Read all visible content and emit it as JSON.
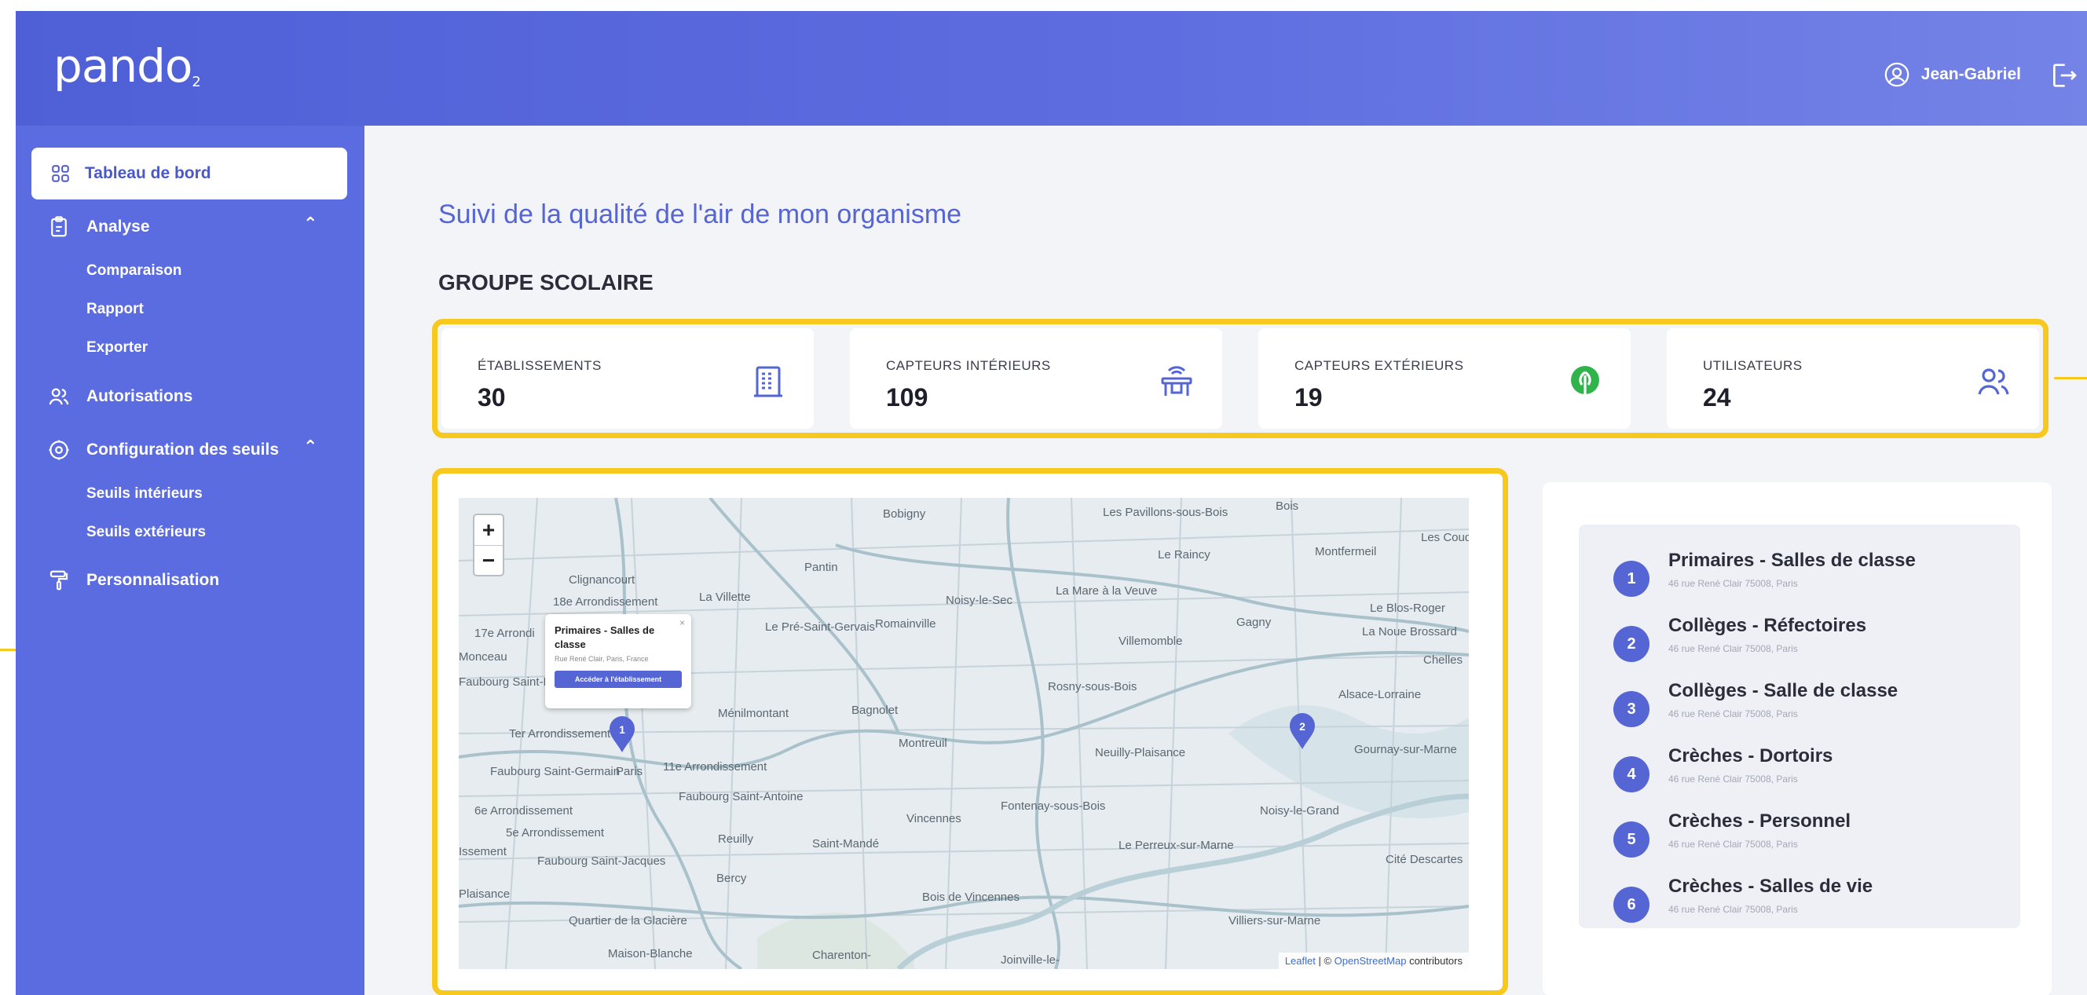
{
  "header": {
    "logo": "pando",
    "logo_sub": "2",
    "user_name": "Jean-Gabriel"
  },
  "sidebar": {
    "items": [
      {
        "label": "Tableau de bord",
        "icon": "grid-icon",
        "active": true
      },
      {
        "label": "Analyse",
        "icon": "clipboard-icon",
        "expanded": true,
        "children": [
          "Comparaison",
          "Rapport",
          "Exporter"
        ]
      },
      {
        "label": "Autorisations",
        "icon": "users-icon"
      },
      {
        "label": "Configuration des seuils",
        "icon": "gear-icon",
        "expanded": true,
        "children": [
          "Seuils intérieurs",
          "Seuils extérieurs"
        ]
      },
      {
        "label": "Personnalisation",
        "icon": "paint-roller-icon"
      }
    ]
  },
  "main": {
    "title": "Suivi de la qualité de l'air de mon organisme",
    "section": "GROUPE SCOLAIRE",
    "stats": [
      {
        "label": "ÉTABLISSEMENTS",
        "value": "30",
        "icon": "building-icon",
        "color": "#5565d4"
      },
      {
        "label": "CAPTEURS INTÉRIEURS",
        "value": "109",
        "icon": "indoor-sensor-icon",
        "color": "#5565d4"
      },
      {
        "label": "CAPTEURS EXTÉRIEURS",
        "value": "19",
        "icon": "tree-icon",
        "color": "#2fb34a"
      },
      {
        "label": "UTILISATEURS",
        "value": "24",
        "icon": "users-icon",
        "color": "#5565d4"
      }
    ]
  },
  "map": {
    "zoom_in": "+",
    "zoom_out": "−",
    "places": [
      "Bobigny",
      "Les Pavillons-sous-Bois",
      "Bois",
      "Pantin",
      "Le Raincy",
      "Montfermeil",
      "Les Coud",
      "Clignancourt",
      "18e Arrondissement",
      "La Villette",
      "Noisy-le-Sec",
      "La Mare à la Veuve",
      "Le Blos-Roger",
      "17e Arrondi",
      "Monceau",
      "Le Pré-Saint-Gervais",
      "Romainville",
      "Gagny",
      "La Noue Brossard",
      "Villemomble",
      "Chelles",
      "Faubourg Saint-Honoré",
      "Rosny-sous-Bois",
      "Alsace-Lorraine",
      "Ménilmontant",
      "Bagnolet",
      "Montreuil",
      "Neuilly-Plaisance",
      "Gournay-sur-Marne",
      "Ter Arrondissement",
      "Faubourg Saint-Germain",
      "Paris",
      "11e Arrondissement",
      "6e Arrondissement",
      "Faubourg Saint-Antoine",
      "5e Arrondissement",
      "Reuilly",
      "Vincennes",
      "Fontenay-sous-Bois",
      "Noisy-le-Grand",
      "Saint-Mandé",
      "Le Perreux-sur-Marne",
      "Cité Descartes",
      "Faubourg Saint-Jacques",
      "Bercy",
      "Bois de Vincennes",
      "Quartier de la Glacière",
      "Maison-Blanche",
      "Charenton-",
      "Villiers-sur-Marne",
      "Joinville-le-",
      "Plaisance",
      "Issement"
    ],
    "popup": {
      "title": "Primaires - Salles de classe",
      "address": "Rue René Clair, Paris, France",
      "button": "Accéder à l'établissement",
      "close": "×"
    },
    "pins": [
      "1",
      "2"
    ],
    "attribution_leaflet": "Leaflet",
    "attribution_sep": " | © ",
    "attribution_osm": "OpenStreetMap",
    "attribution_tail": " contributors"
  },
  "list": {
    "items": [
      {
        "num": "1",
        "title": "Primaires - Salles de classe",
        "address": "46 rue René Clair 75008, Paris"
      },
      {
        "num": "2",
        "title": "Collèges - Réfectoires",
        "address": "46 rue René Clair 75008, Paris"
      },
      {
        "num": "3",
        "title": "Collèges - Salle de classe",
        "address": "46 rue René Clair 75008, Paris"
      },
      {
        "num": "4",
        "title": "Crèches - Dortoirs",
        "address": "46 rue René Clair 75008, Paris"
      },
      {
        "num": "5",
        "title": "Crèches - Personnel",
        "address": "46 rue René Clair 75008, Paris"
      },
      {
        "num": "6",
        "title": "Crèches - Salles de vie",
        "address": "46 rue René Clair 75008, Paris"
      }
    ]
  }
}
